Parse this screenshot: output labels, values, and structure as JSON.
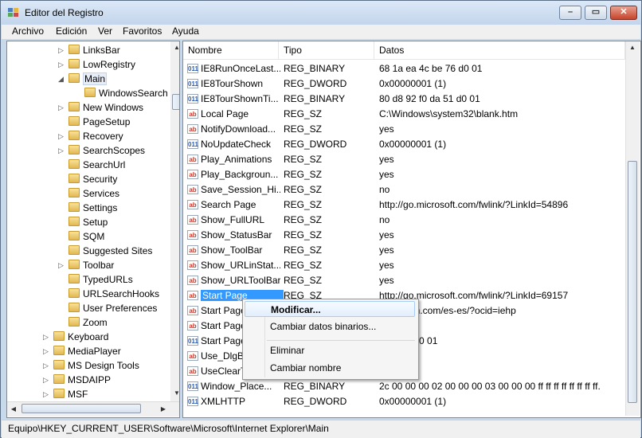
{
  "window": {
    "title": "Editor del Registro"
  },
  "menu": [
    "Archivo",
    "Edición",
    "Ver",
    "Favoritos",
    "Ayuda"
  ],
  "tree": {
    "items": [
      {
        "label": "LinksBar",
        "expander": "▷"
      },
      {
        "label": "LowRegistry",
        "expander": "▷"
      },
      {
        "label": "Main",
        "expander": "◢",
        "selected": true
      },
      {
        "label": "WindowsSearch",
        "expander": ""
      },
      {
        "label": "New Windows",
        "expander": "▷"
      },
      {
        "label": "PageSetup",
        "expander": ""
      },
      {
        "label": "Recovery",
        "expander": "▷"
      },
      {
        "label": "SearchScopes",
        "expander": "▷"
      },
      {
        "label": "SearchUrl",
        "expander": ""
      },
      {
        "label": "Security",
        "expander": ""
      },
      {
        "label": "Services",
        "expander": ""
      },
      {
        "label": "Settings",
        "expander": ""
      },
      {
        "label": "Setup",
        "expander": ""
      },
      {
        "label": "SQM",
        "expander": ""
      },
      {
        "label": "Suggested Sites",
        "expander": ""
      },
      {
        "label": "Toolbar",
        "expander": "▷"
      },
      {
        "label": "TypedURLs",
        "expander": ""
      },
      {
        "label": "URLSearchHooks",
        "expander": ""
      },
      {
        "label": "User Preferences",
        "expander": ""
      },
      {
        "label": "Zoom",
        "expander": ""
      },
      {
        "label": "Keyboard",
        "expander": "▷"
      },
      {
        "label": "MediaPlayer",
        "expander": "▷"
      },
      {
        "label": "MS Design Tools",
        "expander": "▷"
      },
      {
        "label": "MSDAIPP",
        "expander": "▷"
      },
      {
        "label": "MSF",
        "expander": "▷"
      }
    ]
  },
  "list": {
    "columns": [
      "Nombre",
      "Tipo",
      "Datos"
    ],
    "rows": [
      {
        "name": "IE8RunOnceLast...",
        "type": "REG_BINARY",
        "data": "68 1a ea 4c be 76 d0 01",
        "icon": "bin"
      },
      {
        "name": "IE8TourShown",
        "type": "REG_DWORD",
        "data": "0x00000001 (1)",
        "icon": "bin"
      },
      {
        "name": "IE8TourShownTi...",
        "type": "REG_BINARY",
        "data": "80 d8 92 f0 da 51 d0 01",
        "icon": "bin"
      },
      {
        "name": "Local Page",
        "type": "REG_SZ",
        "data": "C:\\Windows\\system32\\blank.htm",
        "icon": "sz"
      },
      {
        "name": "NotifyDownload...",
        "type": "REG_SZ",
        "data": "yes",
        "icon": "sz"
      },
      {
        "name": "NoUpdateCheck",
        "type": "REG_DWORD",
        "data": "0x00000001 (1)",
        "icon": "bin"
      },
      {
        "name": "Play_Animations",
        "type": "REG_SZ",
        "data": "yes",
        "icon": "sz"
      },
      {
        "name": "Play_Backgroun...",
        "type": "REG_SZ",
        "data": "yes",
        "icon": "sz"
      },
      {
        "name": "Save_Session_Hi...",
        "type": "REG_SZ",
        "data": "no",
        "icon": "sz"
      },
      {
        "name": "Search Page",
        "type": "REG_SZ",
        "data": "http://go.microsoft.com/fwlink/?LinkId=54896",
        "icon": "sz"
      },
      {
        "name": "Show_FullURL",
        "type": "REG_SZ",
        "data": "no",
        "icon": "sz"
      },
      {
        "name": "Show_StatusBar",
        "type": "REG_SZ",
        "data": "yes",
        "icon": "sz"
      },
      {
        "name": "Show_ToolBar",
        "type": "REG_SZ",
        "data": "yes",
        "icon": "sz"
      },
      {
        "name": "Show_URLinStat...",
        "type": "REG_SZ",
        "data": "yes",
        "icon": "sz"
      },
      {
        "name": "Show_URLToolBar",
        "type": "REG_SZ",
        "data": "yes",
        "icon": "sz"
      },
      {
        "name": "Start Page",
        "type": "REG_SZ",
        "data": "http://go.microsoft.com/fwlink/?LinkId=69157",
        "icon": "sz",
        "selected": true
      },
      {
        "name": "Start Page",
        "type": "",
        "data": "www.msn.com/es-es/?ocid=iehp",
        "icon": "sz"
      },
      {
        "name": "Start Page",
        "type": "",
        "data": "",
        "icon": "sz"
      },
      {
        "name": "Start Page",
        "type": "",
        "data": "3 8a 95 d0 01",
        "icon": "bin"
      },
      {
        "name": "Use_DlgBo",
        "type": "",
        "data": "",
        "icon": "sz"
      },
      {
        "name": "UseClearT",
        "type": "",
        "data": "",
        "icon": "sz"
      },
      {
        "name": "Window_Place...",
        "type": "REG_BINARY",
        "data": "2c 00 00 00 02 00 00 00 03 00 00 00 ff ff ff ff ff ff ff ff...",
        "icon": "bin"
      },
      {
        "name": "XMLHTTP",
        "type": "REG_DWORD",
        "data": "0x00000001 (1)",
        "icon": "bin"
      }
    ]
  },
  "context_menu": {
    "items": [
      "Modificar...",
      "Cambiar datos binarios...",
      "Eliminar",
      "Cambiar nombre"
    ]
  },
  "status": "Equipo\\HKEY_CURRENT_USER\\Software\\Microsoft\\Internet Explorer\\Main"
}
